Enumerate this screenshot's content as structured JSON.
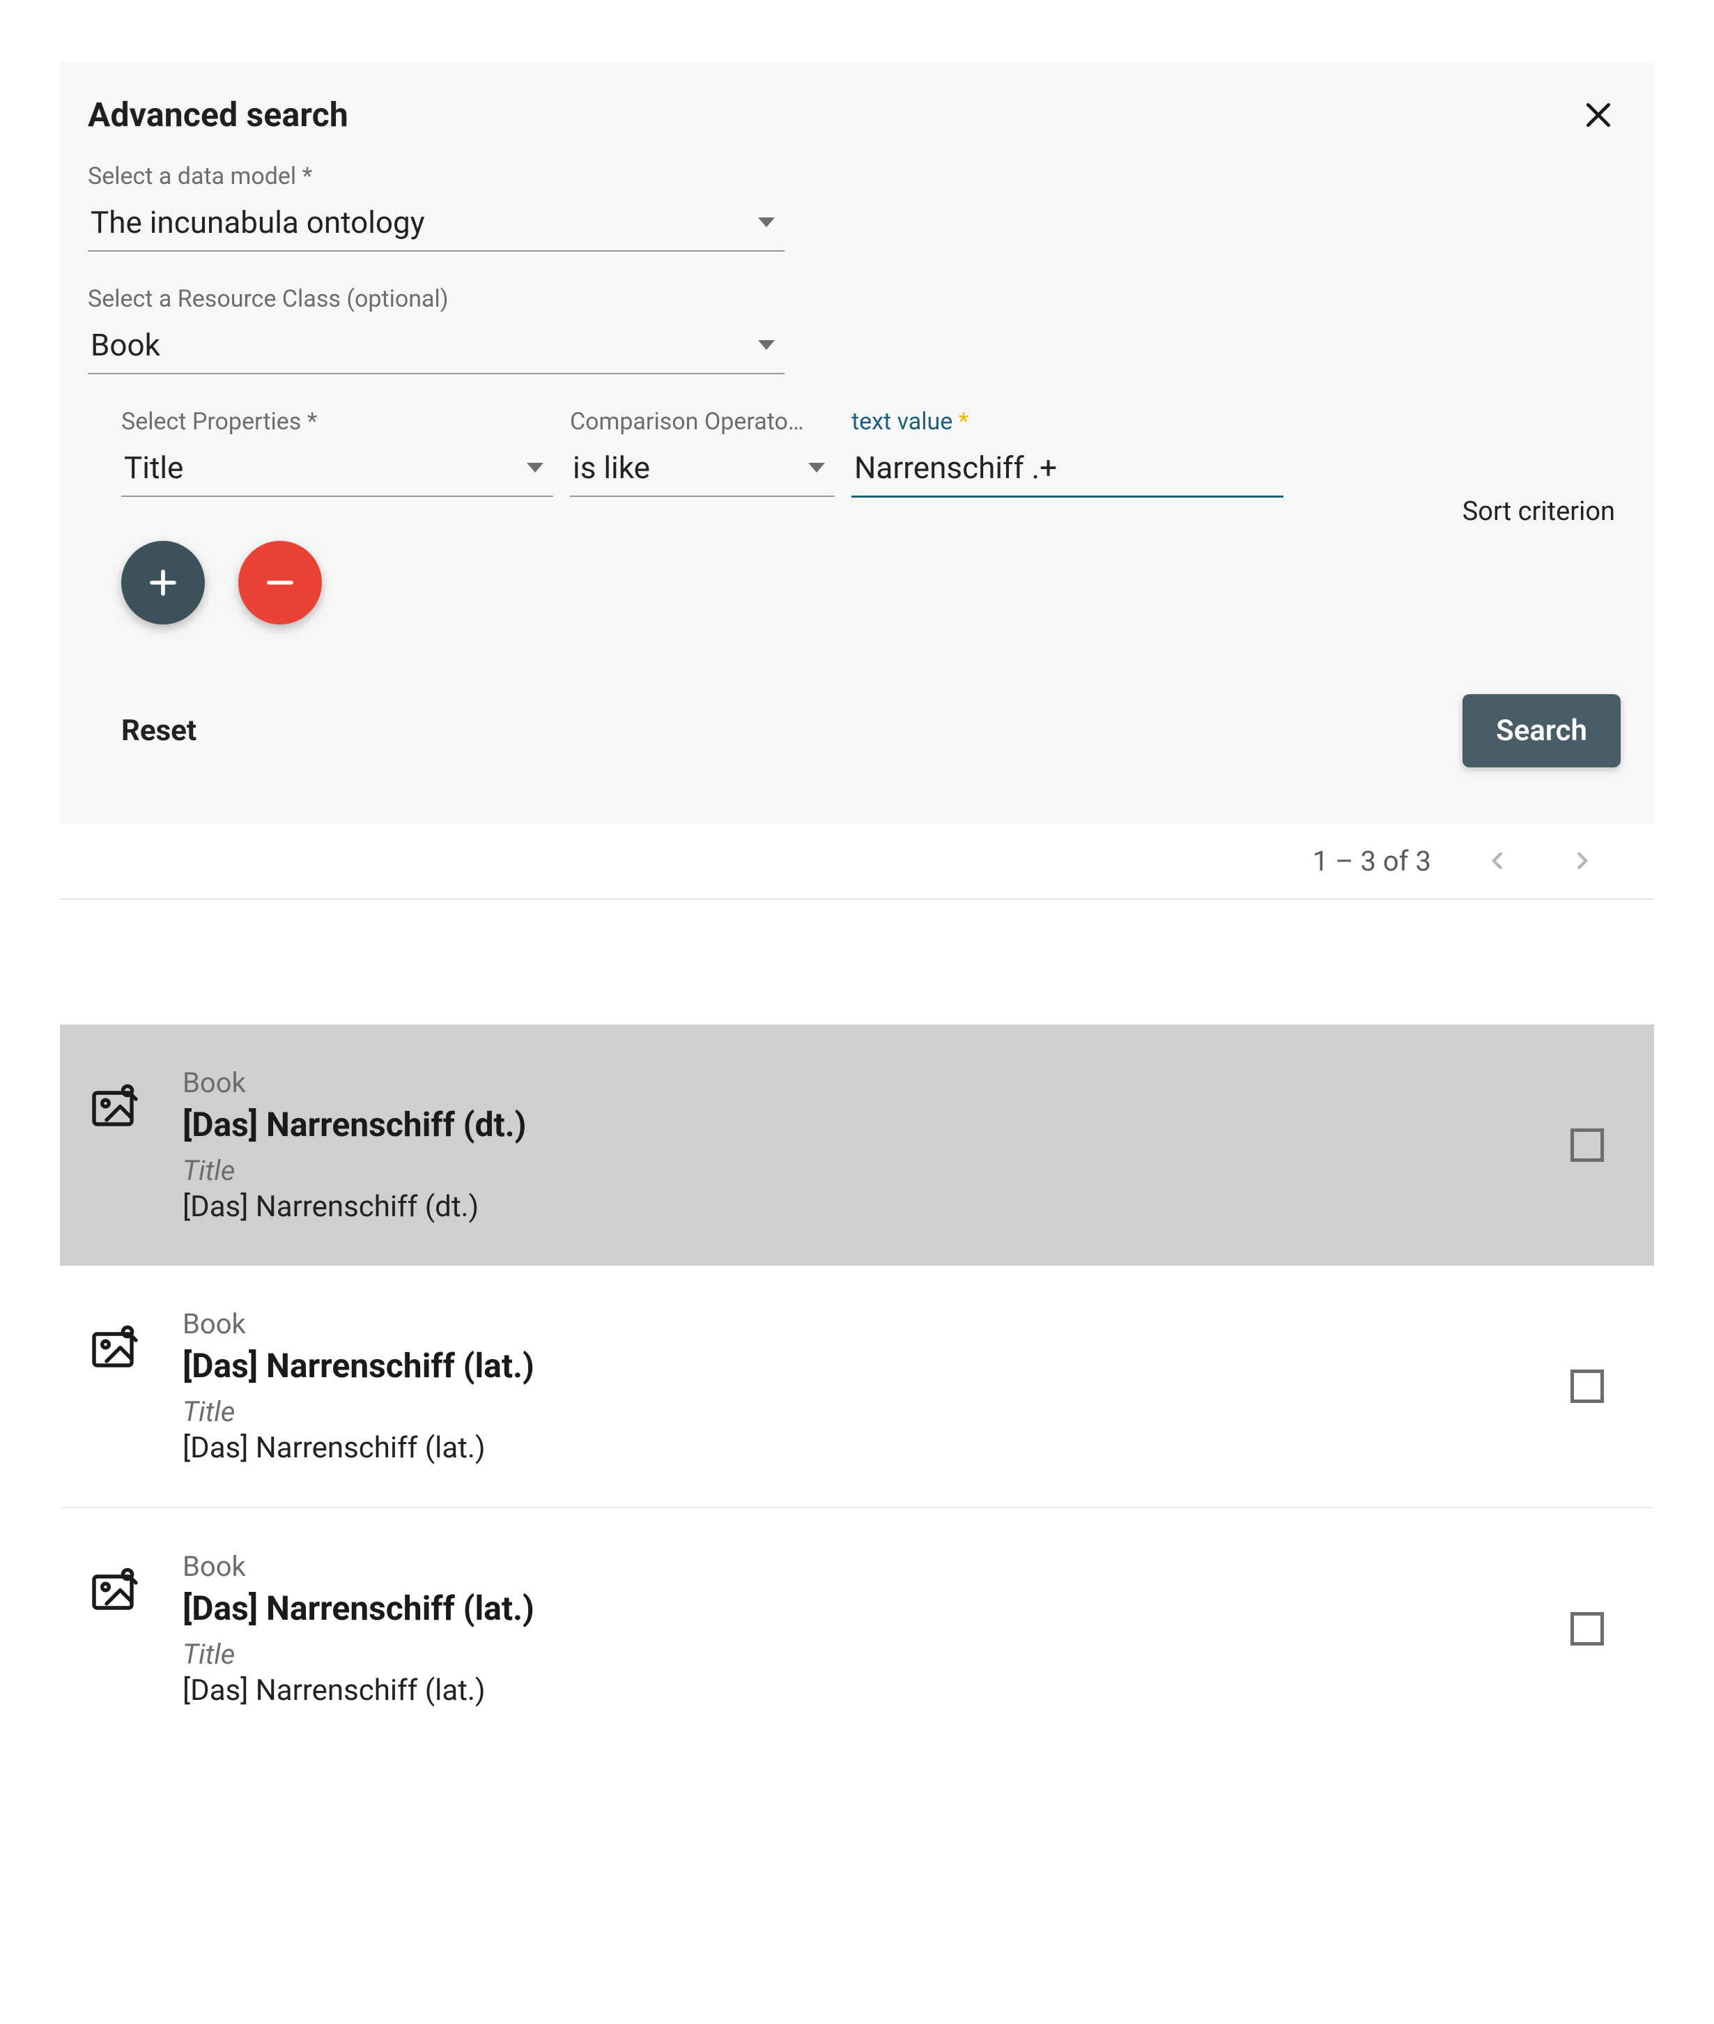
{
  "header": {
    "title": "Advanced search"
  },
  "form": {
    "data_model_label": "Select a data model *",
    "data_model_value": "The incunabula ontology",
    "resource_class_label": "Select a Resource Class (optional)",
    "resource_class_value": "Book",
    "property_label": "Select Properties *",
    "property_value": "Title",
    "operator_label": "Comparison Operato…",
    "operator_value": "is like",
    "text_value_label": "text value",
    "text_value": "Narrenschiff .+"
  },
  "sort_label": "Sort criterion",
  "actions": {
    "reset": "Reset",
    "search": "Search"
  },
  "pager": {
    "range": "1 – 3 of 3"
  },
  "results": [
    {
      "type": "Book",
      "title": "[Das] Narrenschiff (dt.)",
      "prop_label": "Title",
      "prop_value": "[Das] Narrenschiff (dt.)",
      "selected": true
    },
    {
      "type": "Book",
      "title": "[Das] Narrenschiff (lat.)",
      "prop_label": "Title",
      "prop_value": "[Das] Narrenschiff (lat.)",
      "selected": false
    },
    {
      "type": "Book",
      "title": "[Das] Narrenschiff (lat.)",
      "prop_label": "Title",
      "prop_value": "[Das] Narrenschiff (lat.)",
      "selected": false
    }
  ]
}
